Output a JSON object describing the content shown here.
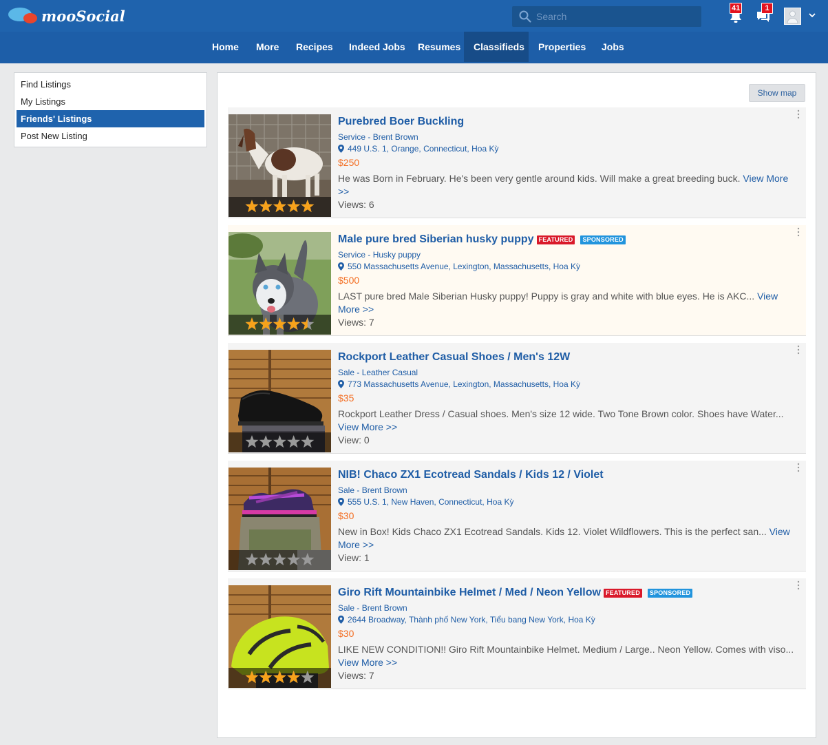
{
  "app": {
    "name": "mooSocial"
  },
  "search": {
    "placeholder": "Search"
  },
  "notifications": {
    "count": "41"
  },
  "messages": {
    "count": "1"
  },
  "nav": {
    "items": [
      "Home",
      "More",
      "Recipes",
      "Indeed Jobs",
      "Resumes",
      "Classifieds",
      "Properties",
      "Jobs"
    ],
    "active": "Classifieds"
  },
  "sidebar": {
    "items": [
      "Find Listings",
      "My Listings",
      "Friends' Listings",
      "Post New Listing"
    ],
    "active": "Friends' Listings"
  },
  "main": {
    "show_map_label": "Show map"
  },
  "listings": [
    {
      "title": "Purebred Boer Buckling",
      "category": "Service",
      "author": "Brent Brown",
      "address": "449 U.S. 1, Orange, Connecticut, Hoa Kỳ",
      "price": "$250",
      "description": "He was Born in February. He's been very gentle around kids. Will make a great breeding buck.",
      "view_more": "View More >>",
      "views": "Views: 6",
      "rating": 5,
      "featured": false,
      "sponsored": false
    },
    {
      "title": "Male pure bred Siberian husky puppy",
      "category": "Service",
      "author": "Husky puppy",
      "address": "550 Massachusetts Avenue, Lexington, Massachusetts, Hoa Kỳ",
      "price": "$500",
      "description": "LAST pure bred Male Siberian Husky puppy! Puppy is gray and white with blue eyes. He is AKC...",
      "view_more": "View More >>",
      "views": "Views: 7",
      "rating": 4.5,
      "featured": true,
      "sponsored": true
    },
    {
      "title": "Rockport Leather Casual Shoes / Men's 12W",
      "category": "Sale",
      "author": "Leather Casual",
      "address": "773 Massachusetts Avenue, Lexington, Massachusetts, Hoa Kỳ",
      "price": "$35",
      "description": "Rockport Leather Dress / Casual shoes. Men's size 12 wide. Two Tone Brown color. Shoes have Water...",
      "view_more": "View More >>",
      "views": "View: 0",
      "rating": 0,
      "featured": false,
      "sponsored": false
    },
    {
      "title": "NIB! Chaco ZX1 Ecotread Sandals / Kids 12 / Violet",
      "category": "Sale",
      "author": "Brent Brown",
      "address": "555 U.S. 1, New Haven, Connecticut, Hoa Kỳ",
      "price": "$30",
      "description": "New in Box! Kids Chaco ZX1 Ecotread Sandals. Kids 12. Violet Wildflowers. This is the perfect san...",
      "view_more": "View More >>",
      "views": "View: 1",
      "rating": 0,
      "featured": false,
      "sponsored": false
    },
    {
      "title": "Giro Rift Mountainbike Helmet / Med / Neon Yellow",
      "category": "Sale",
      "author": "Brent Brown",
      "address": "2644 Broadway, Thành phố New York, Tiểu bang New York, Hoa Kỳ",
      "price": "$30",
      "description": "LIKE NEW CONDITION!! Giro Rift Mountainbike Helmet. Medium / Large.. Neon Yellow. Comes with viso...",
      "view_more": "View More >>",
      "views": "Views: 7",
      "rating": 4,
      "featured": true,
      "sponsored": true
    }
  ],
  "labels": {
    "featured": "FEATURED",
    "sponsored": "SPONSORED",
    "meta_separator": " - "
  },
  "colors": {
    "primary": "#1f63ad",
    "link": "#1f5da6",
    "price": "#f36d21",
    "star": "#f7a21b",
    "featured": "#d9192a",
    "sponsored": "#2294dd"
  }
}
